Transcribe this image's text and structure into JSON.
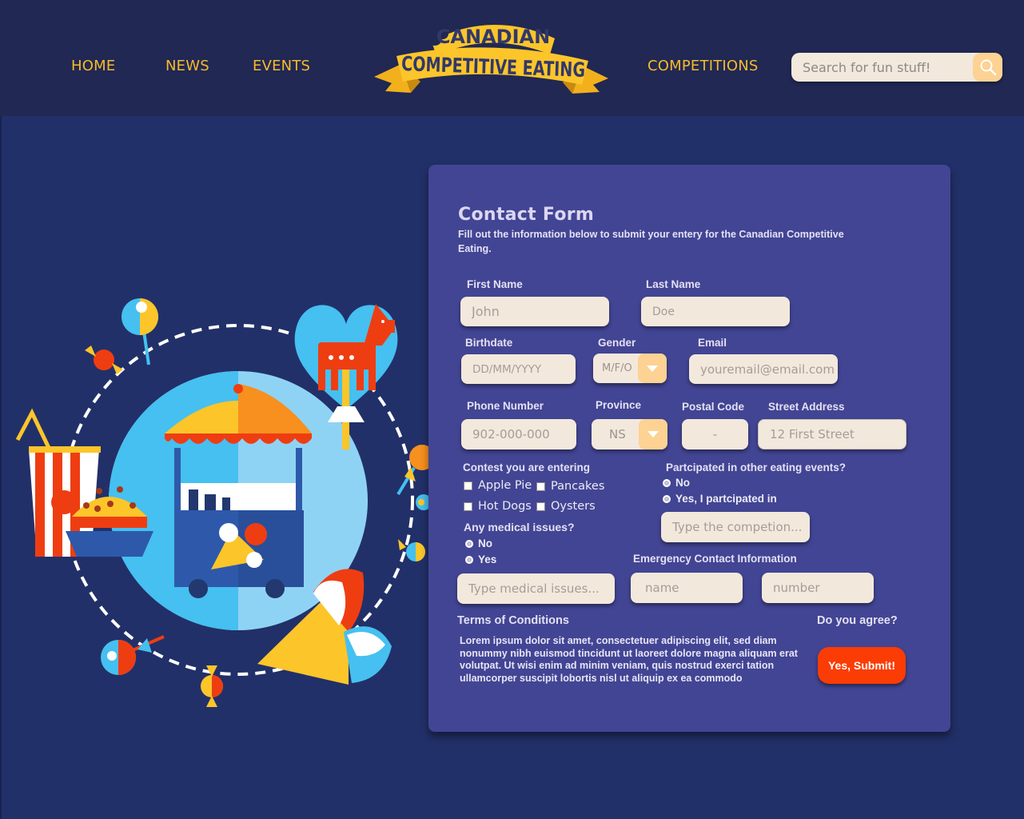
{
  "nav": {
    "home": "HOME",
    "news": "NEWS",
    "events": "EVENTS",
    "competitions": "COMPETITIONS"
  },
  "logo": {
    "line1": "CANADIAN",
    "line2": "COMPETITIVE EATING"
  },
  "search": {
    "placeholder": "Search for fun stuff!"
  },
  "form": {
    "title": "Contact Form",
    "subtitle": "Fill out the information below to submit your entery for the Canadian Competitive Eating.",
    "first_name": {
      "label": "First Name",
      "placeholder": "John"
    },
    "last_name": {
      "label": "Last Name",
      "placeholder": "Doe"
    },
    "birthdate": {
      "label": "Birthdate",
      "placeholder": "DD/MM/YYYY"
    },
    "gender": {
      "label": "Gender",
      "value": "M/F/O"
    },
    "email": {
      "label": "Email",
      "placeholder": "youremail@email.com"
    },
    "phone": {
      "label": "Phone Number",
      "placeholder": "902-000-000"
    },
    "province": {
      "label": "Province",
      "value": "NS"
    },
    "postal": {
      "label": "Postal Code",
      "placeholder": "-"
    },
    "street": {
      "label": "Street Address",
      "placeholder": "12 First Street"
    },
    "contest": {
      "label": "Contest you are entering",
      "options": [
        "Apple Pie",
        "Pancakes",
        "Hot Dogs",
        "Oysters"
      ]
    },
    "participated": {
      "label": "Partcipated in other eating events?",
      "options": [
        "No",
        "Yes, I partcipated in"
      ],
      "placeholder": "Type the competion..."
    },
    "medical": {
      "label": "Any medical issues?",
      "options": [
        "No",
        "Yes"
      ],
      "placeholder": "Type medical issues..."
    },
    "emergency": {
      "label": "Emergency Contact Information",
      "name_placeholder": "name",
      "number_placeholder": "number"
    },
    "terms": {
      "label": "Terms of Conditions",
      "text": "Lorem ipsum dolor sit amet, consectetuer adipiscing elit, sed diam nonummy nibh euismod tincidunt ut laoreet dolore magna aliquam erat volutpat. Ut wisi enim ad minim veniam, quis nostrud exerci tation ullamcorper suscipit lobortis nisl ut aliquip ex ea commodo"
    },
    "agree": {
      "label": "Do you agree?",
      "submit": "Yes, Submit!"
    }
  },
  "colors": {
    "header_bg": "#202853",
    "page_bg": "#223069",
    "card_bg": "#424593",
    "nav_text": "#f8b92b",
    "field_bg": "#f3e8dc",
    "accent": "#fdd292",
    "submit": "#fb3c05"
  }
}
